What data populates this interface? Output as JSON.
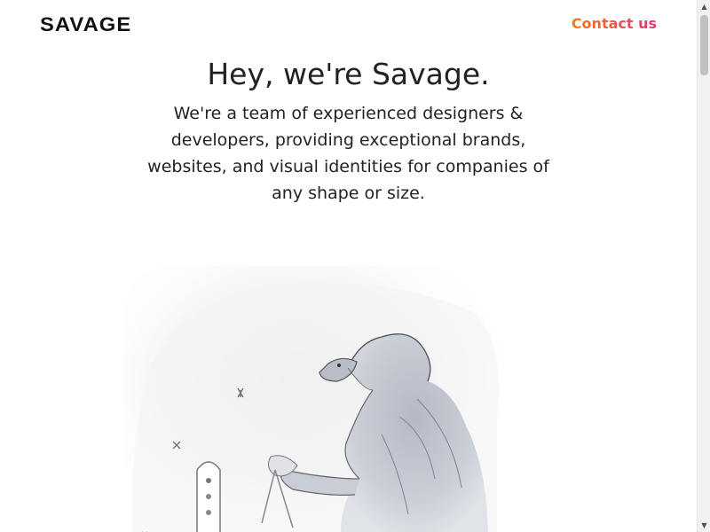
{
  "header": {
    "logo_text": "SAVAGE",
    "contact_label": "Contact us"
  },
  "hero": {
    "title": "Hey, we're Savage.",
    "description": "We're a team of experienced designers & developers, providing exceptional brands, websites, and visual identities for companies of any shape or size."
  },
  "illustration": {
    "subject": "ape-sketch-illustration"
  },
  "scrollbar": {
    "up_glyph": "▲",
    "down_glyph": "▼"
  },
  "colors": {
    "contact_gradient_start": "#f07a1a",
    "contact_gradient_end": "#e0357a",
    "text": "#222222",
    "background": "#ffffff"
  }
}
